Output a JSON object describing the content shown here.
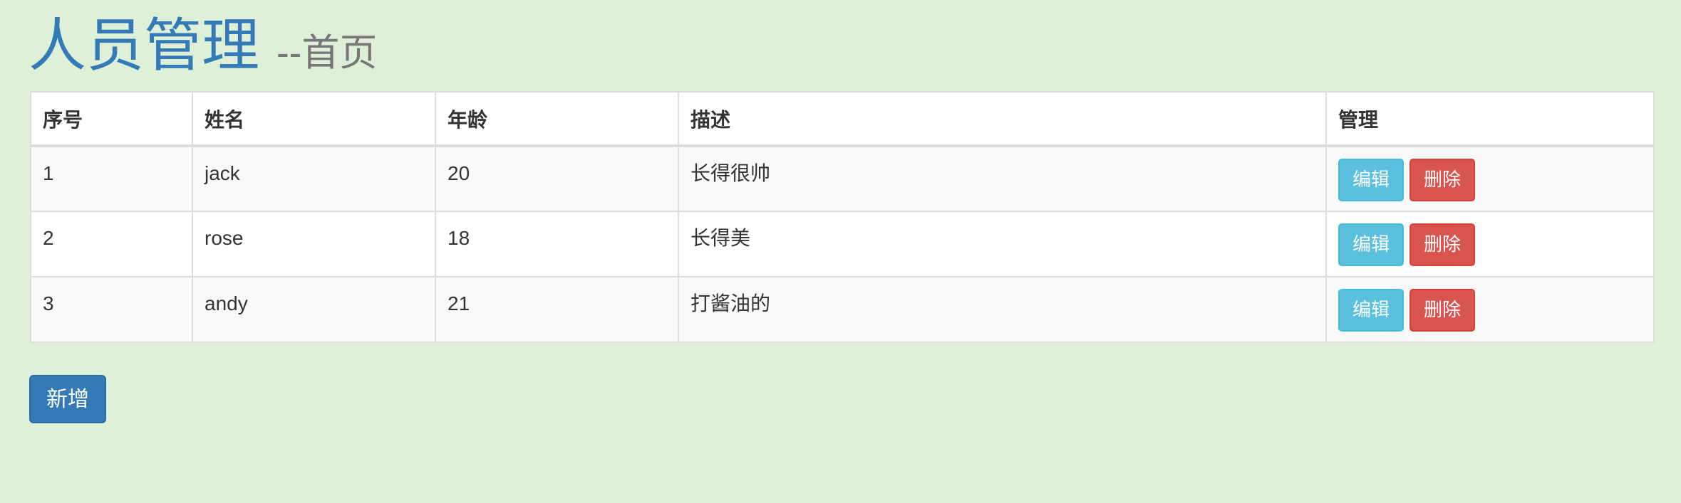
{
  "header": {
    "title": "人员管理",
    "subtitle": "--首页"
  },
  "table": {
    "columns": [
      "序号",
      "姓名",
      "年龄",
      "描述",
      "管理"
    ],
    "rows": [
      {
        "id": "1",
        "name": "jack",
        "age": "20",
        "description": "长得很帅"
      },
      {
        "id": "2",
        "name": "rose",
        "age": "18",
        "description": "长得美"
      },
      {
        "id": "3",
        "name": "andy",
        "age": "21",
        "description": "打酱油的"
      }
    ],
    "edit_label": "编辑",
    "delete_label": "删除"
  },
  "actions": {
    "add_label": "新增"
  },
  "colors": {
    "background": "#dff0d8",
    "title": "#337ab7",
    "edit_button": "#5bc0de",
    "delete_button": "#d9534f",
    "add_button": "#337ab7"
  }
}
